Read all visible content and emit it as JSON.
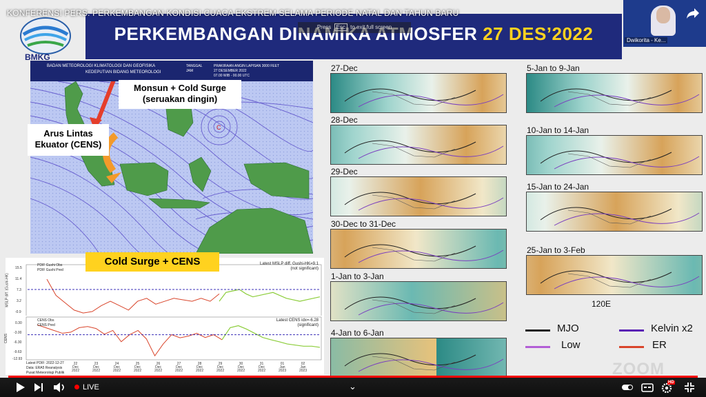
{
  "video": {
    "title": "KONFERENSI PERS: PERKEMBANGAN KONDISI CUACA EKSTREM SELAMA PERIODE NATAL DAN TAHUN BARU",
    "fullscreen_hint": {
      "prefix": "Press",
      "key": "Esc",
      "suffix": "to exit full screen"
    },
    "live_label": "LIVE",
    "progress": 1.0,
    "accent": "#ff0000"
  },
  "speaker": {
    "name": "Dwikorita - Ke..."
  },
  "slide": {
    "title_main": "PERKEMBANGAN DINAMIKA ATMOSFER",
    "title_date": "27 DES’2022",
    "logo_text": "BMKG",
    "banner_color": "#1f2a7c",
    "date_color": "#ffd21f",
    "map": {
      "org_line1": "BADAN METEOROLOGI KLIMATOLOGI DAN GEOFISIKA",
      "org_line2": "KEDEPUTIAN BIDANG METEOROLOGI",
      "info_labels": [
        "TANGGAL",
        "JAM"
      ],
      "info_values": [
        "PRAKIRAAN ANGIN LAPISAN 3000 FEET",
        "27 DESEMBER 2022",
        "07.00 WIB - 00.00 UTC"
      ],
      "callout_monsun": [
        "Monsun + Cold Surge",
        "(seruakan dingin)"
      ],
      "callout_cens": [
        "Arus Lintas",
        "Ekuator (CENS)"
      ]
    },
    "cold_surge_label": "Cold Surge + CENS",
    "ts_top": {
      "legend": [
        "PDIF Gushi Obs",
        "PDIF Gushi Pred"
      ],
      "note": [
        "Latest MSLP diff. Gushi-HK=9.1",
        "(not significant)"
      ],
      "yticks": [
        "15.5",
        "11.4",
        "7.3",
        "3.2",
        "-0.9"
      ],
      "ylabel": "MSLP diff. (Gushi-HK)",
      "values": [
        11.5,
        6,
        3.5,
        1,
        0,
        0.5,
        2.5,
        4,
        2.5,
        1,
        4,
        5,
        3,
        4,
        5,
        4.5,
        4,
        5,
        4,
        6.5
      ],
      "pred": [
        4,
        7,
        7.5,
        8,
        6.5,
        5.5,
        6,
        6.5,
        7,
        6,
        5,
        4.5,
        4,
        4.5,
        5,
        5.5
      ],
      "threshold": 8
    },
    "ts_bot": {
      "legend": [
        "CENS Obs",
        "CENS Pred"
      ],
      "note": [
        "Latest CENS idx=-6.28",
        "(significant)"
      ],
      "yticks": [
        "0.30",
        "-3.00",
        "-6.30",
        "-9.63",
        "-12.93"
      ],
      "ylabel": "CENS",
      "xticks": [
        [
          "22",
          "Dec",
          "2022"
        ],
        [
          "23",
          "Dec",
          "2022"
        ],
        [
          "24",
          "Dec",
          "2022"
        ],
        [
          "25",
          "Dec",
          "2022"
        ],
        [
          "26",
          "Dec",
          "2022"
        ],
        [
          "27",
          "Dec",
          "2022"
        ],
        [
          "28",
          "Dec",
          "2022"
        ],
        [
          "29",
          "Dec",
          "2022"
        ],
        [
          "30",
          "Dec",
          "2022"
        ],
        [
          "31",
          "Dec",
          "2022"
        ],
        [
          "01",
          "Jan",
          "2023"
        ],
        [
          "02",
          "Jan",
          "2023"
        ]
      ],
      "bottom_text": [
        "Latest PDIF: 2022-12-27",
        "Data: ERA5 Reanalysis",
        "Pusat Meteorologi Publik"
      ]
    },
    "panels_left": [
      "27-Dec",
      "28-Dec",
      "29-Dec",
      "30-Dec to 31-Dec",
      "1-Jan to 3-Jan",
      "4-Jan to 6-Jan"
    ],
    "panels_right": [
      "5-Jan to 9-Jan",
      "10-Jan to 14-Jan",
      "15-Jan to 24-Jan",
      "25-Jan to 3-Feb"
    ],
    "axis_label": "120E",
    "legend": [
      {
        "label": "MJO",
        "color": "#222222"
      },
      {
        "label": "Kelvin x2",
        "color": "#5a1fb5"
      },
      {
        "label": "Low",
        "color": "#b35ed6"
      },
      {
        "label": "ER",
        "color": "#d9452b"
      }
    ],
    "watermark": "ZOOM"
  }
}
